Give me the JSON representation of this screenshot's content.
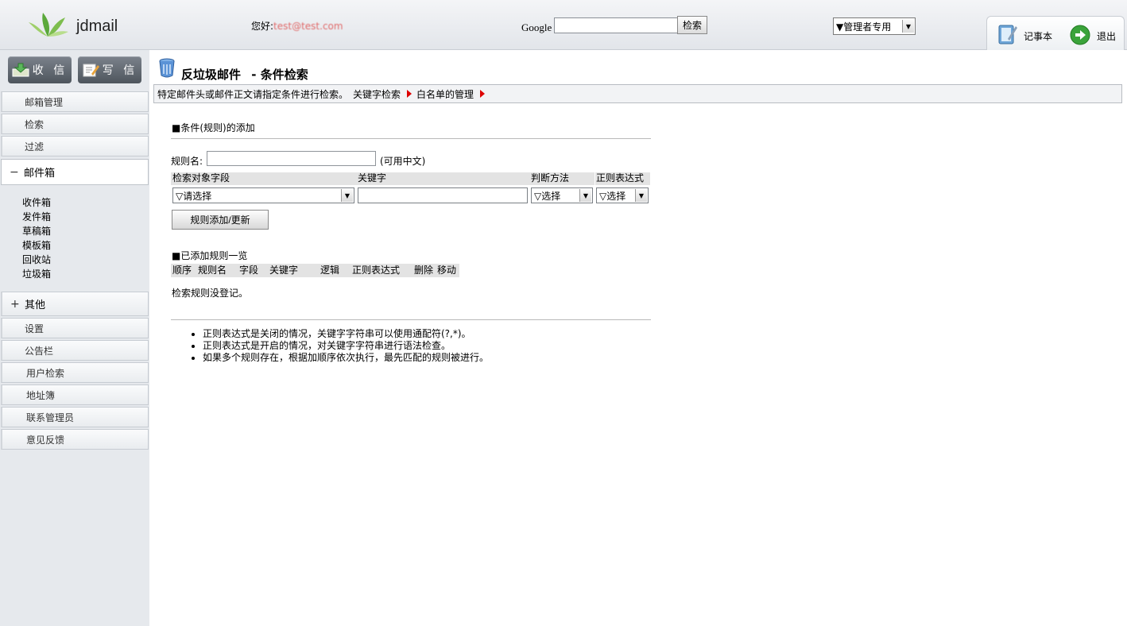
{
  "header": {
    "app_name": "jdmail",
    "greeting": "您好:",
    "user": "test@test.com",
    "google_label": "Google",
    "google_search_value": "",
    "search_button": "检索",
    "admin_select": "▼管理者专用",
    "notepad": "记事本",
    "logout": "退出"
  },
  "sidebar": {
    "receive": "收 信",
    "write": "写 信",
    "items_top": [
      "邮箱管理",
      "检索",
      "过滤"
    ],
    "mailbox": {
      "sign": "−",
      "label": "邮件箱"
    },
    "mailboxes": [
      "收件箱",
      "发件箱",
      "草稿箱",
      "模板箱",
      "回收站",
      "垃圾箱"
    ],
    "other": {
      "sign": "+",
      "label": "其他"
    },
    "items_bottom": [
      "设置",
      "公告栏",
      "用户检索",
      "地址簿",
      "联系管理员",
      "意见反馈"
    ]
  },
  "main": {
    "title": "反垃圾邮件",
    "title_sub": "- 条件检索",
    "info": "特定邮件头或邮件正文请指定条件进行检索。",
    "link_keyword": "关键字检索",
    "link_whitelist": "白名单的管理",
    "add_section": "■条件(规则)的添加",
    "rule_name_label": "规则名:",
    "rule_name_value": "",
    "rule_name_hint": "(可用中文)",
    "col_field": "检索对象字段",
    "col_keyword": "关键字",
    "col_method": "判断方法",
    "col_regex": "正则表达式",
    "field_select": "▽请选择",
    "keyword_value": "",
    "method_select": "▽选择",
    "regex_select": "▽选择",
    "add_button": "规则添加/更新",
    "list_section": "■已添加规则一览",
    "list_cols": [
      "顺序",
      "规则名",
      "字段",
      "关键字",
      "逻辑",
      "正则表达式",
      "删除",
      "移动"
    ],
    "no_rules": "检索规则没登记。",
    "notes": [
      "正则表达式是关闭的情况，关键字字符串可以使用通配符(?,*)。",
      "正则表达式是开启的情况，对关键字字符串进行语法检查。",
      "如果多个规则存在，根据加顺序依次执行，最先匹配的规则被进行。"
    ]
  }
}
